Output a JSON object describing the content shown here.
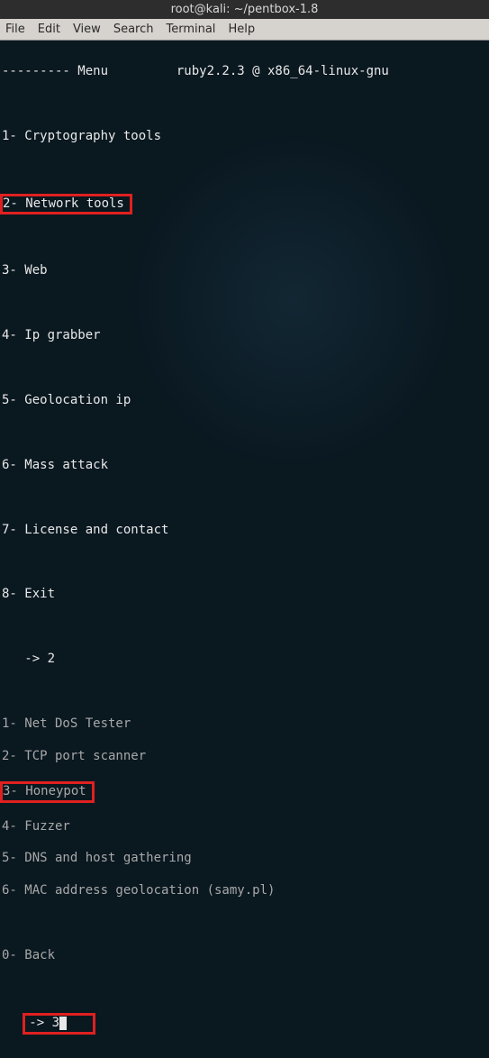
{
  "window": {
    "title": "root@kali: ~/pentbox-1.8"
  },
  "menubar": {
    "file": "File",
    "edit": "Edit",
    "view": "View",
    "search": "Search",
    "terminal": "Terminal",
    "help": "Help"
  },
  "terminal": {
    "header": "--------- Menu         ruby2.2.3 @ x86_64-linux-gnu",
    "main_menu": {
      "m1": "1- Cryptography tools",
      "m2": "2- Network tools",
      "m3": "3- Web",
      "m4": "4- Ip grabber",
      "m5": "5- Geolocation ip",
      "m6": "6- Mass attack",
      "m7": "7- License and contact",
      "m8": "8- Exit"
    },
    "prompt1": "   -> 2",
    "net_menu": {
      "n1": "1- Net DoS Tester",
      "n2": "2- TCP port scanner",
      "n3": "3- Honeypot",
      "n4": "4- Fuzzer",
      "n5": "5- DNS and host gathering",
      "n6": "6- MAC address geolocation (samy.pl)",
      "n0": "0- Back"
    },
    "prompt2_prefix": "   -> 3"
  },
  "highlights": {
    "item1": "2- Network tools",
    "item2": "3- Honeypot",
    "item3_prompt": "-> 3"
  }
}
